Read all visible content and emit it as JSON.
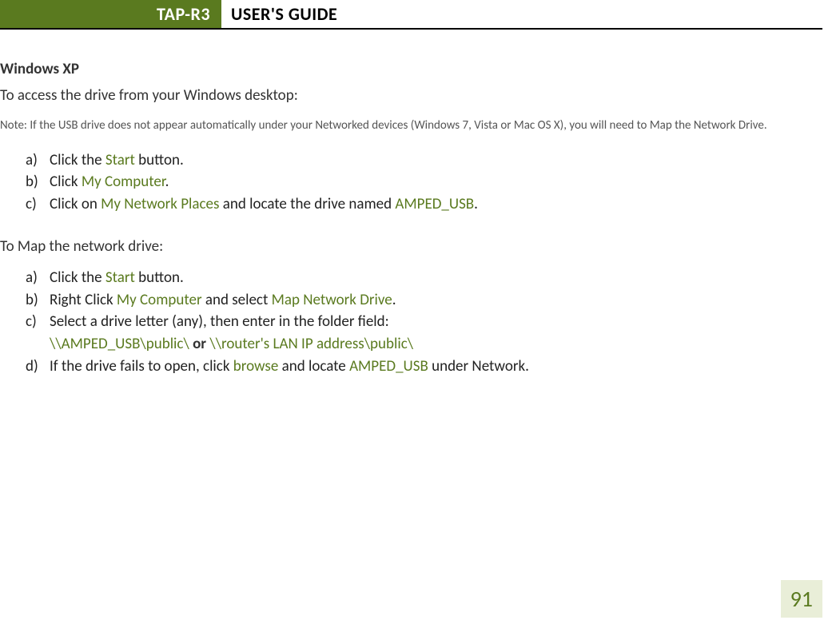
{
  "header": {
    "tag": "TAP-R3",
    "title": "USER'S GUIDE"
  },
  "section_title": "Windows XP",
  "intro_line": "To access the drive from your Windows desktop:",
  "note": "Note: If the USB drive does not appear automatically under your Networked devices (Windows 7, Vista or Mac OS X), you will need to Map the Network Drive.",
  "steps1": {
    "a": {
      "marker": "a)",
      "pre": "Click the ",
      "kw1": "Start",
      "post": " button."
    },
    "b": {
      "marker": "b)",
      "pre": "Click ",
      "kw1": "My Computer",
      "post": "."
    },
    "c": {
      "marker": "c)",
      "pre": "Click on ",
      "kw1": "My Network Places",
      "mid": " and locate the drive named ",
      "kw2": "AMPED_USB",
      "post": "."
    }
  },
  "subheading": "To Map the network drive:",
  "steps2": {
    "a": {
      "marker": "a)",
      "pre": "Click the ",
      "kw1": "Start",
      "post": " button."
    },
    "b": {
      "marker": "b)",
      "pre": "Right Click ",
      "kw1": "My Computer",
      "mid": " and select ",
      "kw2": "Map Network Drive",
      "post": "."
    },
    "c": {
      "marker": "c)",
      "line": "Select a drive letter (any), then enter in the folder field:"
    },
    "c_sub": {
      "kw1": "\\\\AMPED_USB\\public\\",
      "bold": " or ",
      "kw2": "\\\\router's LAN IP address\\public\\"
    },
    "d": {
      "marker": "d)",
      "pre": "If the drive fails to open, click ",
      "kw1": "browse",
      "mid": " and locate ",
      "kw2": "AMPED_USB",
      "post": " under Network."
    }
  },
  "page_number": "91"
}
